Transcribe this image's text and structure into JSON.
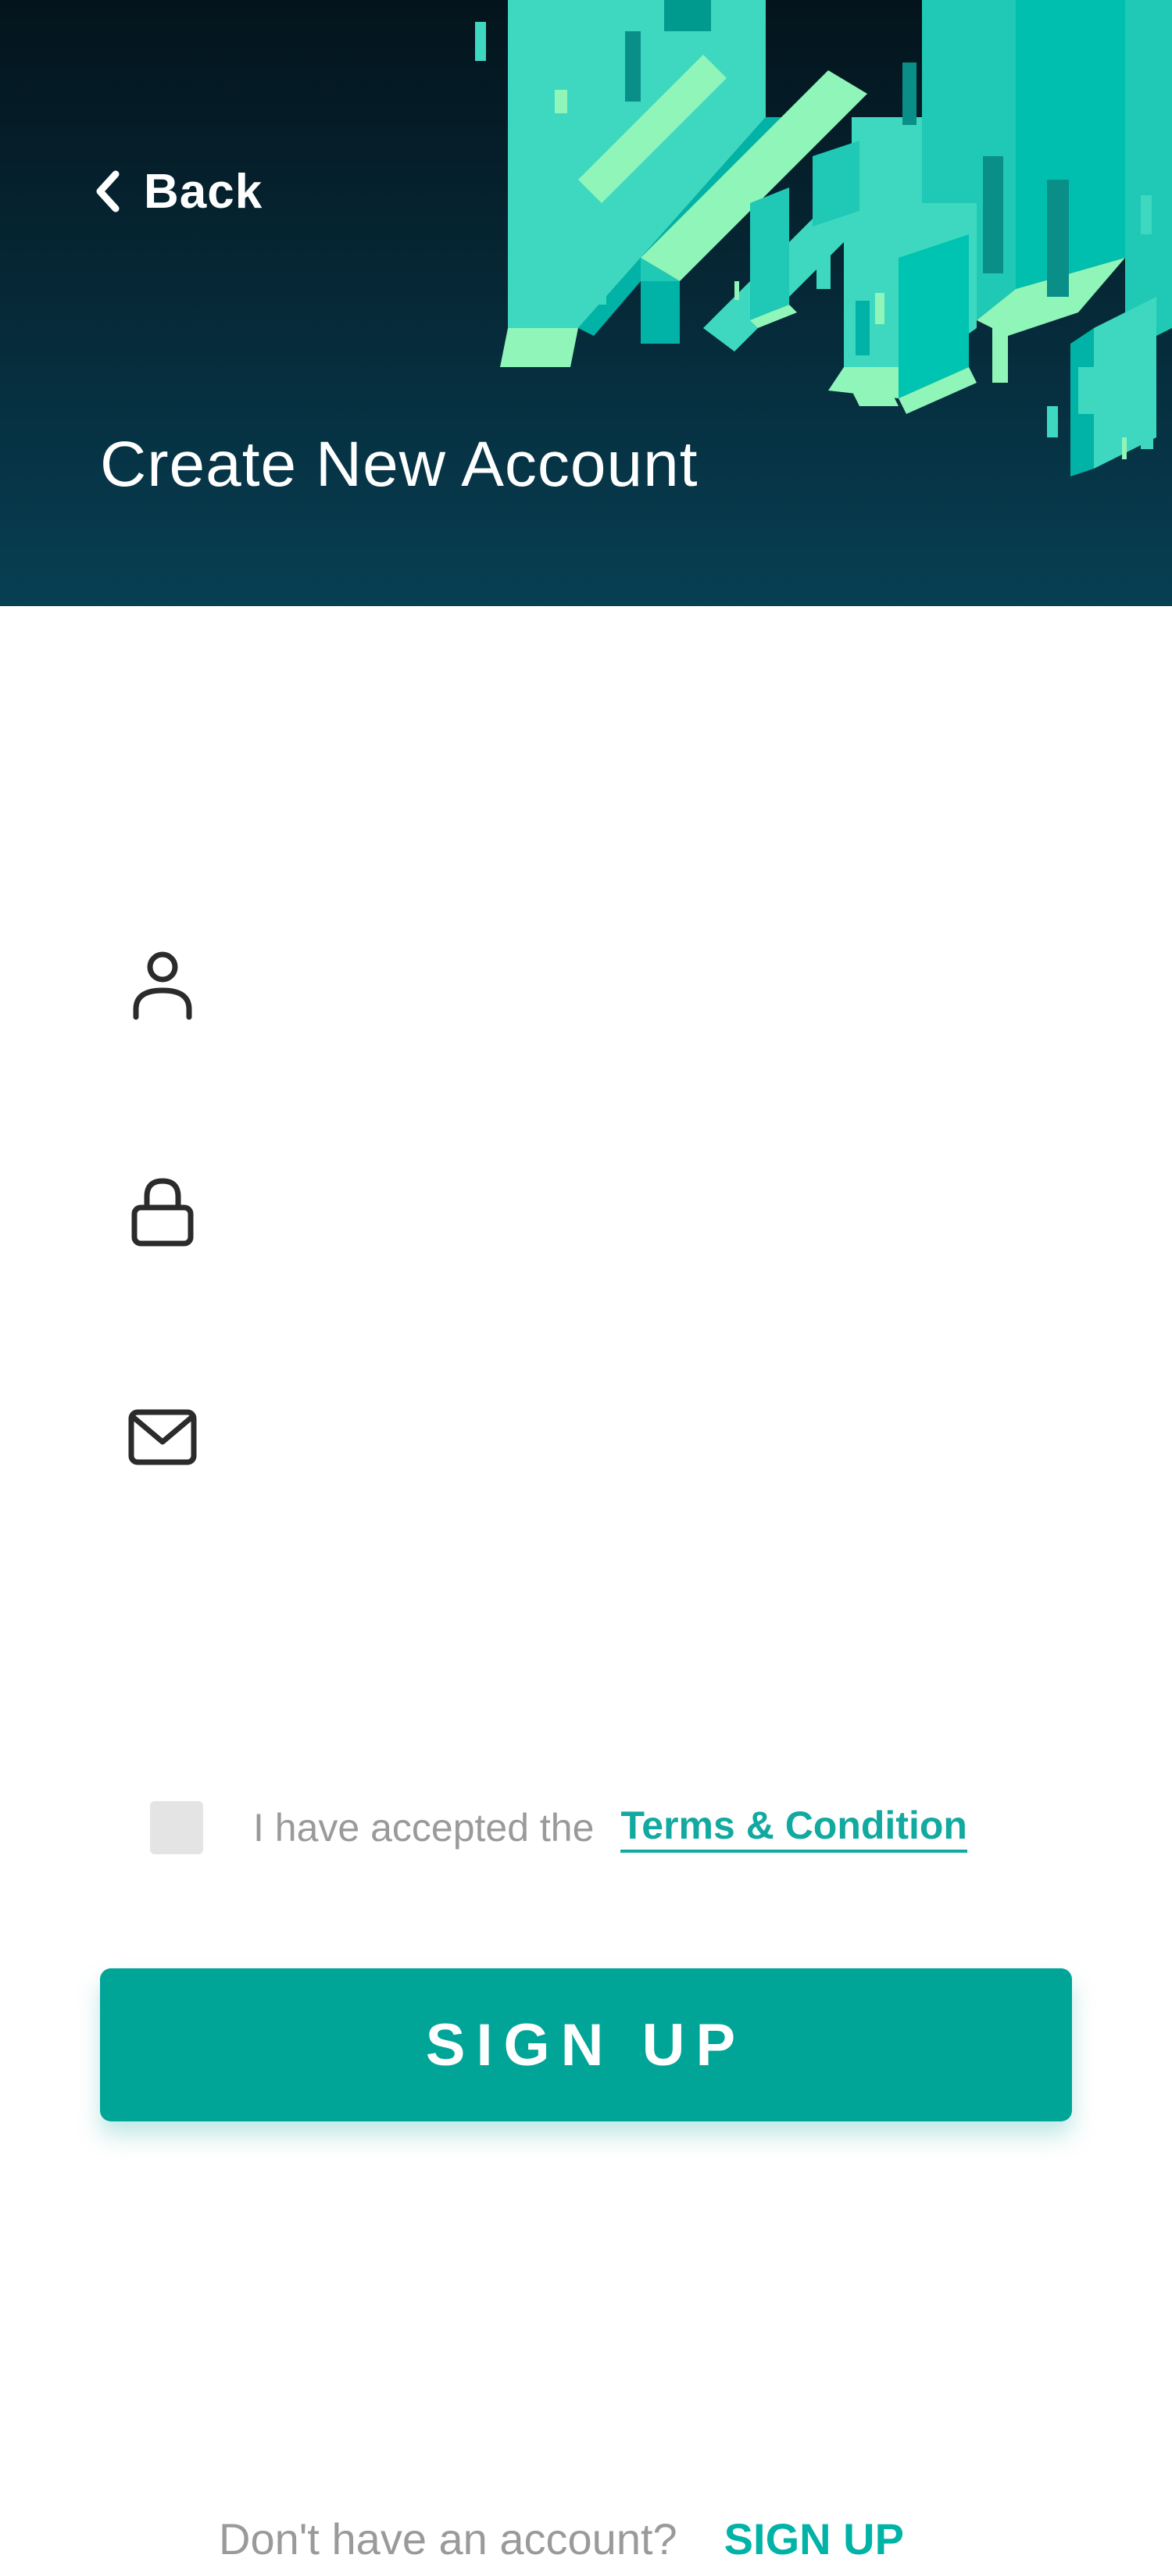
{
  "header": {
    "back_label": "Back",
    "title": "Create New Account"
  },
  "form": {
    "username": {
      "icon": "user-icon",
      "value": "",
      "placeholder": ""
    },
    "password": {
      "icon": "lock-icon",
      "value": "",
      "placeholder": ""
    },
    "email": {
      "icon": "mail-icon",
      "value": "",
      "placeholder": ""
    }
  },
  "terms": {
    "checked": false,
    "prefix": "I have accepted the",
    "link": "Terms & Condition"
  },
  "signup_button": "SIGN UP",
  "footer": {
    "text": "Don't have an account?",
    "link": "SIGN UP"
  },
  "colors": {
    "header_top": "#04141c",
    "header_bottom": "#073f53",
    "accent": "#00a598",
    "link": "#12aaa0",
    "crystal_light": "#8ff5b8",
    "crystal_mid": "#3ed8c0",
    "crystal_dark": "#00b3a6"
  }
}
